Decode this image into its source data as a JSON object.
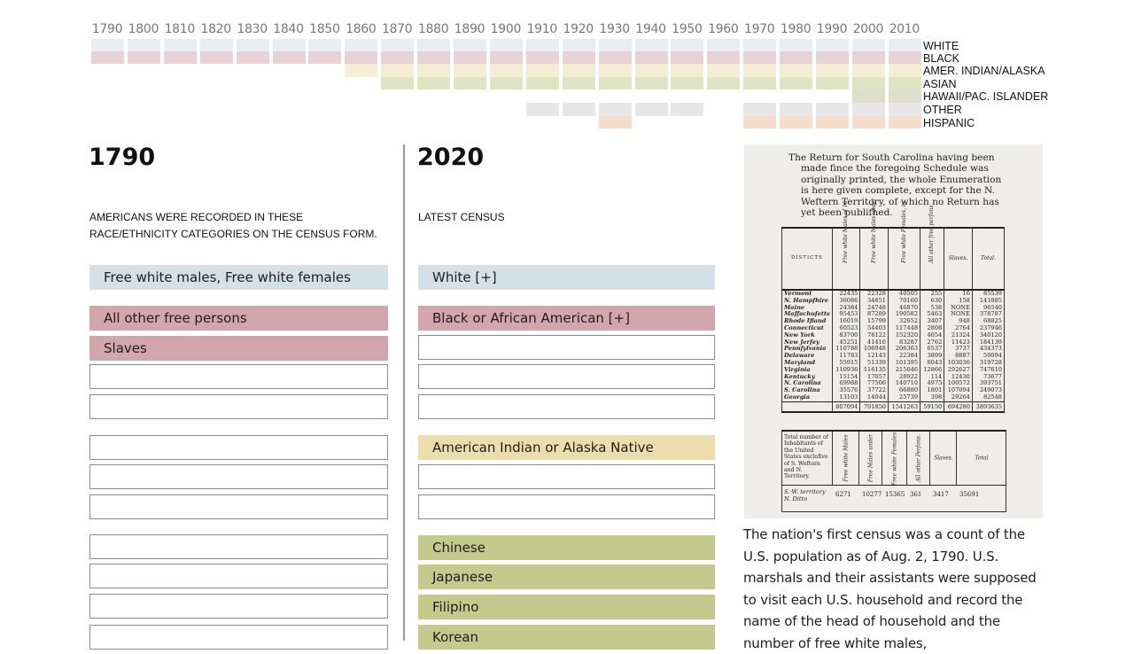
{
  "timeline": {
    "years": [
      "1790",
      "1800",
      "1810",
      "1820",
      "1830",
      "1840",
      "1850",
      "1860",
      "1870",
      "1880",
      "1890",
      "1900",
      "1910",
      "1920",
      "1930",
      "1940",
      "1950",
      "1960",
      "1970",
      "1980",
      "1990",
      "2000",
      "2010"
    ],
    "rows": [
      {
        "key": "white",
        "label": "WHITE",
        "color": "#e7eef3",
        "present_from": "1790",
        "present_years": [
          "1790",
          "1800",
          "1810",
          "1820",
          "1830",
          "1840",
          "1850",
          "1860",
          "1870",
          "1880",
          "1890",
          "1900",
          "1910",
          "1920",
          "1930",
          "1940",
          "1950",
          "1960",
          "1970",
          "1980",
          "1990",
          "2000",
          "2010"
        ]
      },
      {
        "key": "black",
        "label": "BLACK",
        "color": "#e8d2d6",
        "present_years": [
          "1790",
          "1800",
          "1810",
          "1820",
          "1830",
          "1840",
          "1850",
          "1860",
          "1870",
          "1880",
          "1890",
          "1900",
          "1910",
          "1920",
          "1930",
          "1940",
          "1950",
          "1960",
          "1970",
          "1980",
          "1990",
          "2000",
          "2010"
        ]
      },
      {
        "key": "amer_indian",
        "label": "AMER. INDIAN/ALASKA",
        "color": "#f5ecd6",
        "present_years": [
          "1860",
          "1870",
          "1880",
          "1890",
          "1900",
          "1910",
          "1920",
          "1930",
          "1940",
          "1950",
          "1960",
          "1970",
          "1980",
          "1990",
          "2000",
          "2010"
        ]
      },
      {
        "key": "asian",
        "label": "ASIAN",
        "color": "#dfe4c4",
        "present_years": [
          "1870",
          "1880",
          "1890",
          "1900",
          "1910",
          "1920",
          "1930",
          "1940",
          "1950",
          "1960",
          "1970",
          "1980",
          "1990",
          "2000",
          "2010"
        ]
      },
      {
        "key": "hawaii",
        "label": "HAWAII/PAC. ISLANDER",
        "color": "#dfdecd",
        "present_years": [
          "2000",
          "2010"
        ]
      },
      {
        "key": "other",
        "label": "OTHER",
        "color": "#e7e7e9",
        "present_years": [
          "1910",
          "1920",
          "1930",
          "1940",
          "1950",
          "1970",
          "1980",
          "1990",
          "2000",
          "2010"
        ]
      },
      {
        "key": "hispanic",
        "label": "HISPANIC",
        "color": "#f6dccb",
        "present_years": [
          "1930",
          "1970",
          "1980",
          "1990",
          "2000",
          "2010"
        ]
      }
    ]
  },
  "colors": {
    "white_box": "#d4e0e8",
    "black_box": "#d3a6ad",
    "amer_indian_box": "#eddcac",
    "asian_box": "#c3ca8c"
  },
  "left_column": {
    "year": "1790",
    "subtitle": "Americans were recorded in these race/ethnicity categories on the census form.",
    "boxes": [
      {
        "label": "Free white males, Free white females",
        "type": "white"
      },
      {
        "label": "All other free persons",
        "type": "black"
      },
      {
        "label": "Slaves",
        "type": "black"
      },
      {
        "label": "",
        "type": "empty"
      },
      {
        "label": "",
        "type": "empty"
      },
      {
        "label": "",
        "type": "empty"
      },
      {
        "label": "",
        "type": "empty"
      },
      {
        "label": "",
        "type": "empty"
      },
      {
        "label": "",
        "type": "empty"
      },
      {
        "label": "",
        "type": "empty"
      },
      {
        "label": "",
        "type": "empty"
      },
      {
        "label": "",
        "type": "empty"
      }
    ]
  },
  "right_column": {
    "year": "2020",
    "subtitle": "Latest census",
    "boxes": [
      {
        "label": "White [+]",
        "type": "white"
      },
      {
        "label": "Black or African American [+]",
        "type": "black"
      },
      {
        "label": "",
        "type": "empty"
      },
      {
        "label": "",
        "type": "empty"
      },
      {
        "label": "",
        "type": "empty"
      },
      {
        "label": "American Indian or Alaska Native",
        "type": "amer_indian"
      },
      {
        "label": "",
        "type": "empty"
      },
      {
        "label": "",
        "type": "empty"
      },
      {
        "label": "Chinese",
        "type": "asian"
      },
      {
        "label": "Japanese",
        "type": "asian"
      },
      {
        "label": "Filipino",
        "type": "asian"
      },
      {
        "label": "Korean",
        "type": "asian"
      }
    ]
  },
  "document_image": {
    "note_first_line": "The Return  for South Carolina having",
    "note_rest": "been made fince the foregoing Schedule was originally printed, the whole Enumeration is here given complete, except for the N. Weftern Territory, of which no Return has yet been publifhed.",
    "headers": [
      "DISTICTS",
      "Free white Males of 16 years and upwards, including heads of families.",
      "Free white Males under fixteen years.",
      "Free white Females, including heads of families.",
      "All other free perfons.",
      "Slaves.",
      "Total."
    ],
    "rows": [
      [
        "Vermont",
        "22435",
        "22328",
        "40505",
        "255",
        "16",
        "85539"
      ],
      [
        "N. Hampfhire",
        "36086",
        "34851",
        "70160",
        "630",
        "158",
        "141885"
      ],
      [
        "Maine",
        "24384",
        "24748",
        "46870",
        "538",
        "NONE",
        "96540"
      ],
      [
        "Maffachufetts",
        "95453",
        "87289",
        "190582",
        "5463",
        "NONE",
        "378787"
      ],
      [
        "Rhode Ifland",
        "16019",
        "15799",
        "32652",
        "3407",
        "948",
        "68825"
      ],
      [
        "Connecticut",
        "60523",
        "54403",
        "117448",
        "2808",
        "2764",
        "237946"
      ],
      [
        "New York",
        "83700",
        "78122",
        "152320",
        "4654",
        "21324",
        "340120"
      ],
      [
        "New Jerfey",
        "45251",
        "41416",
        "83287",
        "2762",
        "11423",
        "184139"
      ],
      [
        "Pennfylvania",
        "110788",
        "106948",
        "206363",
        "6537",
        "3737",
        "434373"
      ],
      [
        "Delaware",
        "11783",
        "12143",
        "22384",
        "3899",
        "8887",
        "59094"
      ],
      [
        "Maryland",
        "55915",
        "51339",
        "101395",
        "8043",
        "103036",
        "319728"
      ],
      [
        "Virginia",
        "110936",
        "116135",
        "215046",
        "12866",
        "292627",
        "747610"
      ],
      [
        "Kentucky",
        "15154",
        "17057",
        "28922",
        "114",
        "12430",
        "73677"
      ],
      [
        "N. Carolina",
        "69988",
        "77506",
        "140710",
        "4975",
        "100572",
        "393751"
      ],
      [
        "S. Carolina",
        "35576",
        "37722",
        "66880",
        "1801",
        "107094",
        "249073"
      ],
      [
        "Georgia",
        "13103",
        "14044",
        "25739",
        "398",
        "29264",
        "82548"
      ]
    ],
    "totals": [
      "",
      "807094",
      "791850",
      "1541263",
      "59150",
      "694280",
      "3893635"
    ],
    "bottom_label": "Total number of Inhabitants of the United States exclufive of S. Weftern and N. Territory.",
    "bottom_headers": [
      "Free white Males of 21 years and upwards.",
      "Free Males under 21 years of age.",
      "Free white Females.",
      "All other Perfons.",
      "Slaves.",
      "Total"
    ],
    "bottom_row_labels": [
      "S. W. territory",
      "N. Ditto"
    ],
    "bottom_values": [
      "6271",
      "10277",
      "15365",
      "361",
      "3417",
      "35691"
    ]
  },
  "paragraph": "The nation's first census was a count of the U.S. population as of Aug. 2, 1790. U.S. marshals and their assistants were supposed to visit each U.S. household and record the name of the head of household and the number of free white males,"
}
